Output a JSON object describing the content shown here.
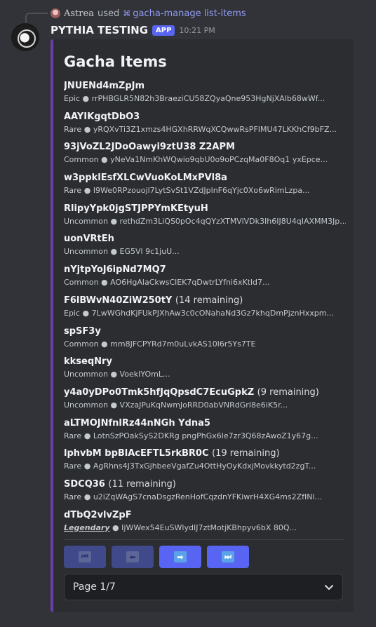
{
  "reply": {
    "user": "Astrea",
    "used_text": "used",
    "command": "gacha-manage list-items"
  },
  "message": {
    "username": "PYTHIA TESTING",
    "badge": "APP",
    "timestamp": "10:21 PM"
  },
  "embed": {
    "accent_color": "#6c3ea8",
    "title": "Gacha Items",
    "items": [
      {
        "name": "JNUENd4mZpJm",
        "remaining": "",
        "rarity": "Epic",
        "description": "rrPHBGLR5N82h3BraeziCU58ZQyaQne953HgNjXAlb68wWf..."
      },
      {
        "name": "AAYIKgqtDbO3",
        "remaining": "",
        "rarity": "Rare",
        "description": "yRQXvTi3Z1xmzs4HGXhRRWqXCQwwRsPFIMU47LKKhCf9bFZ..."
      },
      {
        "name": "93jVoZL2JDoOawyi9ztU38 Z2APM",
        "remaining": "",
        "rarity": "Common",
        "description": "yNeVa1NmKhWQwio9qbU0o9oPCzqMa0F8Oq1 yxEpce..."
      },
      {
        "name": "w3ppklEsfXLCwVuoKoLMxPVl8a",
        "remaining": "",
        "rarity": "Rare",
        "description": "I9We0RPzouojl7LytSvSt1VZdJplnF6qYjc0Xo6wRimLzpa..."
      },
      {
        "name": "RlipyYpk0jgSTJPPYmKEtyuH",
        "remaining": "",
        "rarity": "Uncommon",
        "description": "rethdZm3LiQS0pOc4qQYzXTMViVDk3Ih6IJ8U4qIAXMM3Jp..."
      },
      {
        "name": "uonVRtEh",
        "remaining": "",
        "rarity": "Uncommon",
        "description": "EG5Vl 9c1juU..."
      },
      {
        "name": "nYjtpYoJ6ipNd7MQ7",
        "remaining": "",
        "rarity": "Common",
        "description": "AO6HgAlaCkwsClEK7qDwtrLYfni6xKtld7..."
      },
      {
        "name": "F6lBWvN40ZiW250tY",
        "remaining": "(14 remaining)",
        "rarity": "Epic",
        "description": "7LwWGhdKjFUkPJXhAw3c0cONahaNd3Gz7khqDmPjznHxxpm..."
      },
      {
        "name": "spSF3y",
        "remaining": "",
        "rarity": "Common",
        "description": "mm8JFCPYRd7m0uLvkAS10l6r5Ys7TE"
      },
      {
        "name": "kkseqNry",
        "remaining": "",
        "rarity": "Uncommon",
        "description": "VoekIYOmL..."
      },
      {
        "name": "y4a0yDPo0Tmk5hfJqQpsdC7EcuGpkZ",
        "remaining": "(9 remaining)",
        "rarity": "Uncommon",
        "description": "VXzaJPuKqNwmJoRRD0abVNRdGrI8e6iK5r..."
      },
      {
        "name": "aLTMOJNfnlRz44nNGh Ydna5",
        "remaining": "",
        "rarity": "Rare",
        "description": "LotnSzPOakSyS2DKRg pngPhGx6le7zr3Q68zAwoZ1y67g..."
      },
      {
        "name": "lphvbM bpBlAcEFTL5rkBR0C",
        "remaining": "(19 remaining)",
        "rarity": "Rare",
        "description": "AgRhns4J3TxGjhbeeVgafZu4OttHyOyKdxjMovkkytd2zgT..."
      },
      {
        "name": "SDCQ36",
        "remaining": "(11 remaining)",
        "rarity": "Rare",
        "description": "u2iZqWAgS7cnaDsgzRenHofCqzdnYFKiwrH4XG4ms2ZfINl..."
      },
      {
        "name": "dTbQ2vlvZpF",
        "remaining": "",
        "rarity": "Legendary",
        "description": "IjWWex54EuSWlydIJ7ztMotjKBhpyv6bX 80Q..."
      }
    ],
    "separator": "●"
  },
  "buttons": [
    {
      "name": "first-page-button",
      "icon": "skip-first-icon",
      "glyph": "⏮",
      "disabled": true
    },
    {
      "name": "previous-page-button",
      "icon": "arrow-left-icon",
      "glyph": "⬅",
      "disabled": true
    },
    {
      "name": "next-page-button",
      "icon": "arrow-right-icon",
      "glyph": "➡",
      "disabled": false
    },
    {
      "name": "last-page-button",
      "icon": "skip-last-icon",
      "glyph": "⏭",
      "disabled": false
    }
  ],
  "pagination": {
    "select_value": "Page 1/7"
  }
}
